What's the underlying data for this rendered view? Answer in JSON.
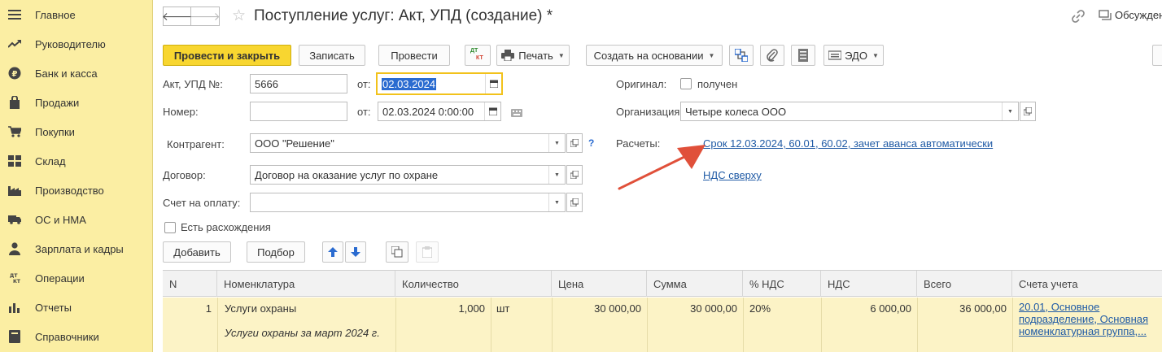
{
  "sidebar": {
    "items": [
      {
        "label": "Главное",
        "icon": "menu-icon"
      },
      {
        "label": "Руководителю",
        "icon": "trend-icon"
      },
      {
        "label": "Банк и касса",
        "icon": "ruble-icon"
      },
      {
        "label": "Продажи",
        "icon": "bag-icon"
      },
      {
        "label": "Покупки",
        "icon": "cart-icon"
      },
      {
        "label": "Склад",
        "icon": "warehouse-icon"
      },
      {
        "label": "Производство",
        "icon": "factory-icon"
      },
      {
        "label": "ОС и НМА",
        "icon": "truck-icon"
      },
      {
        "label": "Зарплата и кадры",
        "icon": "person-icon"
      },
      {
        "label": "Операции",
        "icon": "dt-kt-icon"
      },
      {
        "label": "Отчеты",
        "icon": "bar-chart-icon"
      },
      {
        "label": "Справочники",
        "icon": "book-icon"
      }
    ]
  },
  "header": {
    "title": "Поступление услуг: Акт, УПД (создание) *",
    "discuss_label": "Обсуждение"
  },
  "toolbar": {
    "post_close": "Провести и закрыть",
    "save": "Записать",
    "post": "Провести",
    "dtkt_top": "ДТ",
    "dtkt_bottom": "КТ",
    "print": "Печать",
    "create_based": "Создать на основании",
    "edo": "ЭДО"
  },
  "form": {
    "act_label": "Акт, УПД №:",
    "act_value": "5666",
    "from_label": "от:",
    "act_date": "02.03.2024",
    "number_label": "Номер:",
    "number_value": "",
    "number_from_label": "от:",
    "number_date": "02.03.2024  0:00:00",
    "original_label": "Оригинал:",
    "original_check_label": "получен",
    "org_label": "Организация:",
    "org_value": "Четыре колеса ООО",
    "contractor_label": "Контрагент:",
    "contractor_value": "ООО \"Решение\"",
    "q_mark": "?",
    "settlements_label": "Расчеты:",
    "settlements_link": "Срок 12.03.2024, 60.01, 60.02, зачет аванса автоматически",
    "vat_link": "НДС сверху",
    "contract_label": "Договор:",
    "contract_value": "Договор на оказание услуг по охране",
    "invoice_label": "Счет на оплату:",
    "invoice_value": "",
    "discrepancy_label": "Есть расхождения"
  },
  "table_toolbar": {
    "add": "Добавить",
    "pick": "Подбор"
  },
  "table": {
    "columns": [
      "N",
      "Номенклатура",
      "Количество",
      "Цена",
      "Сумма",
      "% НДС",
      "НДС",
      "Всего",
      "Счета учета"
    ],
    "rows": [
      {
        "n": "1",
        "item": "Услуги охраны",
        "item_desc": "Услуги охраны за март 2024 г.",
        "qty": "1,000",
        "unit": "шт",
        "price": "30 000,00",
        "sum": "30 000,00",
        "vat_rate": "20%",
        "vat": "6 000,00",
        "total": "36 000,00",
        "accounts_line1": "20.01, Основное",
        "accounts_line2": "подразделение, Основная",
        "accounts_line3": "номенклатурная группа,..."
      }
    ]
  },
  "colors": {
    "sidebar_bg": "#fbeea3",
    "primary_button": "#f8d630",
    "link": "#1f5aa5",
    "arrow": "#e0503a",
    "row_highlight": "#fcf3c6"
  }
}
